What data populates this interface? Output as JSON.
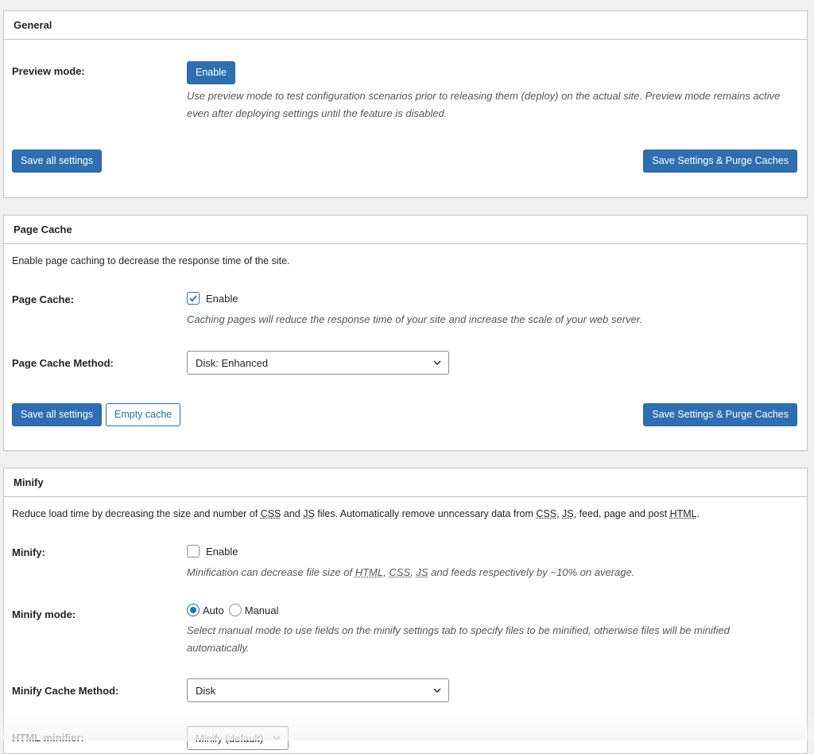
{
  "general": {
    "title": "General",
    "preview_label": "Preview mode:",
    "enable_button": "Enable",
    "preview_desc": "Use preview mode to test configuration scenarios prior to releasing them (deploy) on the actual site. Preview mode remains active even after deploying settings until the feature is disabled.",
    "save_all": "Save all settings",
    "save_purge": "Save Settings & Purge Caches"
  },
  "page_cache": {
    "title": "Page Cache",
    "intro": "Enable page caching to decrease the response time of the site.",
    "label": "Page Cache:",
    "enable_label": "Enable",
    "enabled": true,
    "desc": "Caching pages will reduce the response time of your site and increase the scale of your web server.",
    "method_label": "Page Cache Method:",
    "method_value": "Disk: Enhanced",
    "save_all": "Save all settings",
    "empty_cache": "Empty cache",
    "save_purge": "Save Settings & Purge Caches"
  },
  "minify": {
    "title": "Minify",
    "intro_a": "Reduce load time by decreasing the size and number of ",
    "abbr_css": "CSS",
    "intro_b": " and ",
    "abbr_js": "JS",
    "intro_c": " files. Automatically remove unncessary data from ",
    "abbr_css2": "CSS",
    "intro_d": ", ",
    "abbr_js2": "JS",
    "intro_e": ", feed, page and post ",
    "abbr_html": "HTML",
    "intro_f": ".",
    "label": "Minify:",
    "enable_label": "Enable",
    "enabled": false,
    "desc_a": "Minification can decrease file size of ",
    "desc_html": "HTML",
    "desc_b": ", ",
    "desc_css": "CSS",
    "desc_c": ", ",
    "desc_js": "JS",
    "desc_d": " and feeds respectively by ~10% on average.",
    "mode_label": "Minify mode:",
    "mode_auto": "Auto",
    "mode_manual": "Manual",
    "mode_selected": "Auto",
    "mode_desc": "Select manual mode to use fields on the minify settings tab to specify files to be minified, otherwise files will be minified automatically.",
    "cache_method_label": "Minify Cache Method:",
    "cache_method_value": "Disk",
    "html_minifier_label": "HTML minifier:",
    "html_minifier_value": "Minify (default)"
  }
}
